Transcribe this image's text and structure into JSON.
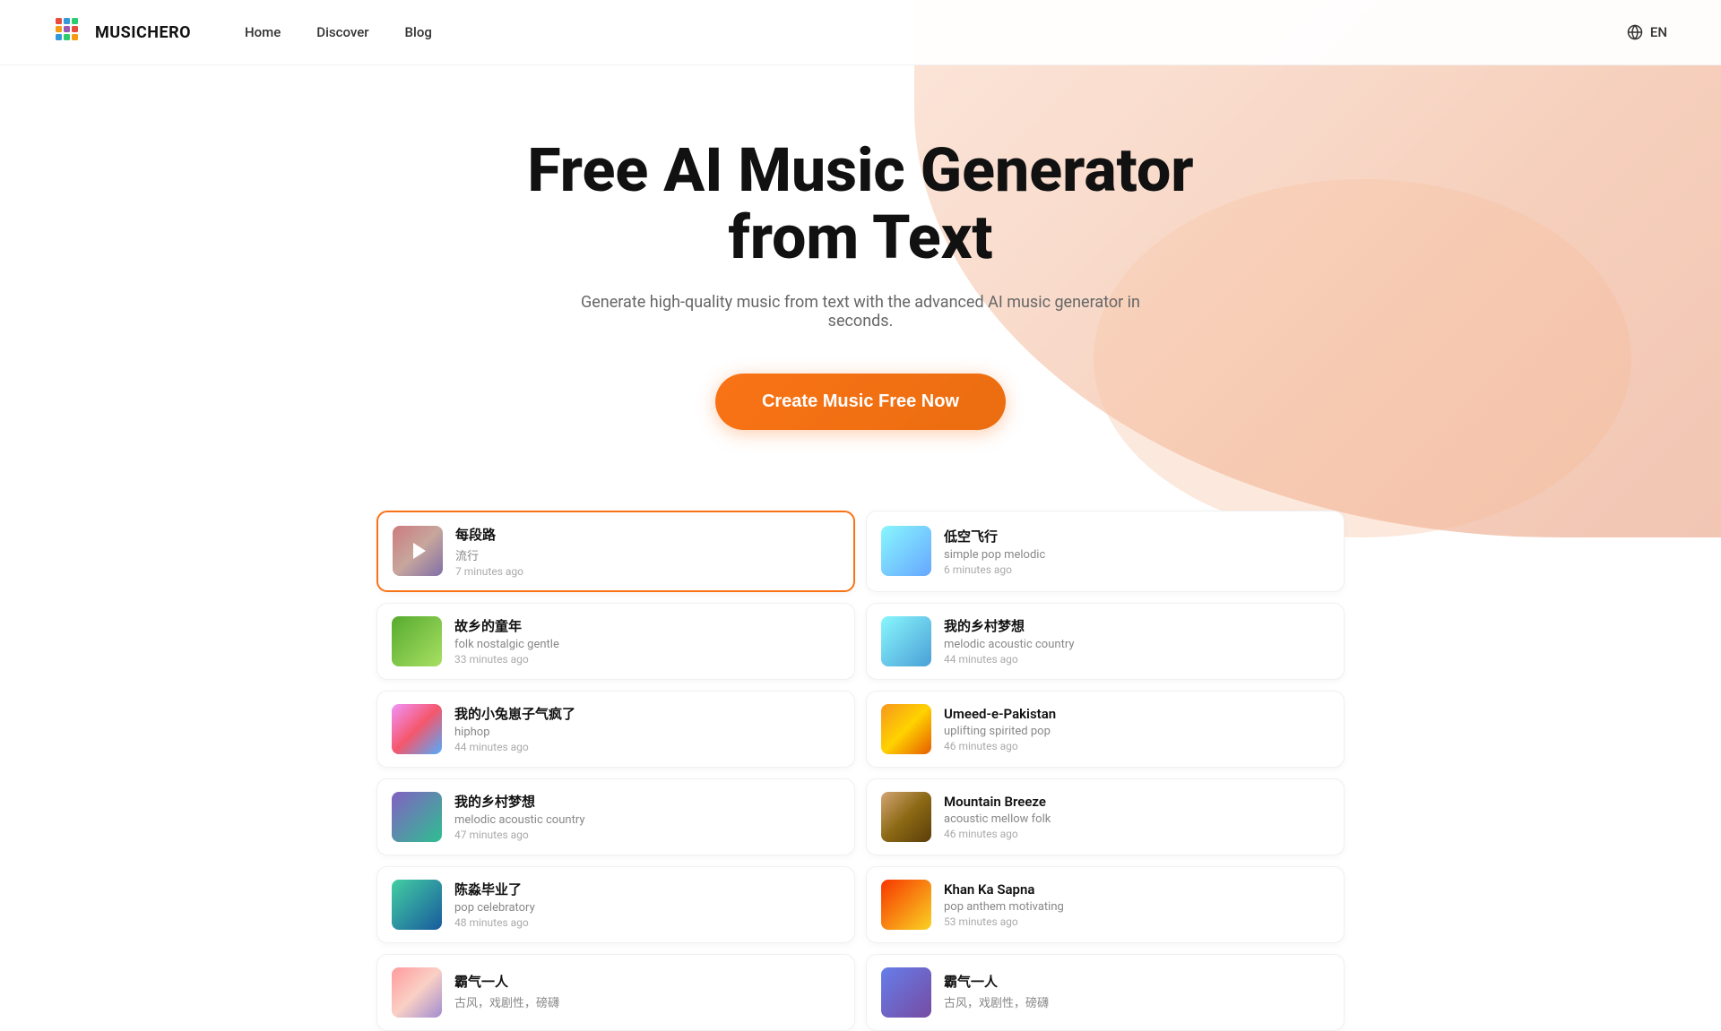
{
  "nav": {
    "logo_text": "MUSICHERO",
    "links": [
      {
        "label": "Home",
        "id": "home"
      },
      {
        "label": "Discover",
        "id": "discover"
      },
      {
        "label": "Blog",
        "id": "blog"
      }
    ],
    "lang": "EN"
  },
  "hero": {
    "title_line1": "Free AI Music Generator",
    "title_line2": "from Text",
    "subtitle": "Generate high-quality music from text with the advanced AI music generator in seconds.",
    "cta_label": "Create Music Free Now"
  },
  "music_cards": [
    {
      "id": "card1",
      "title": "每段路",
      "tags": "流行",
      "time": "7 minutes ago",
      "active": true,
      "thumb_class": "thumb-colorful1"
    },
    {
      "id": "card2",
      "title": "低空飞行",
      "tags": "simple pop melodic",
      "time": "6 minutes ago",
      "active": false,
      "thumb_class": "thumb-sky"
    },
    {
      "id": "card3",
      "title": "故乡的童年",
      "tags": "folk nostalgic gentle",
      "time": "33 minutes ago",
      "active": false,
      "thumb_class": "thumb-nature1"
    },
    {
      "id": "card4",
      "title": "我的乡村梦想",
      "tags": "melodic acoustic country",
      "time": "44 minutes ago",
      "active": false,
      "thumb_class": "thumb-water"
    },
    {
      "id": "card5",
      "title": "我的小兔崽子气疯了",
      "tags": "hiphop",
      "time": "44 minutes ago",
      "active": false,
      "thumb_class": "thumb-mandala"
    },
    {
      "id": "card6",
      "title": "Umeed-e-Pakistan",
      "tags": "uplifting spirited pop",
      "time": "46 minutes ago",
      "active": false,
      "thumb_class": "thumb-sunset"
    },
    {
      "id": "card7",
      "title": "我的乡村梦想",
      "tags": "melodic acoustic country",
      "time": "47 minutes ago",
      "active": false,
      "thumb_class": "thumb-purple"
    },
    {
      "id": "card8",
      "title": "Mountain Breeze",
      "tags": "acoustic mellow folk",
      "time": "46 minutes ago",
      "active": false,
      "thumb_class": "thumb-desert"
    },
    {
      "id": "card9",
      "title": "陈淼毕业了",
      "tags": "pop celebratory",
      "time": "48 minutes ago",
      "active": false,
      "thumb_class": "thumb-landscape"
    },
    {
      "id": "card10",
      "title": "Khan Ka Sapna",
      "tags": "pop anthem motivating",
      "time": "53 minutes ago",
      "active": false,
      "thumb_class": "thumb-fire"
    },
    {
      "id": "card11",
      "title": "霸气一人",
      "tags": "古风，戏剧性，磅礴",
      "time": "",
      "active": false,
      "thumb_class": "thumb-colorful1"
    },
    {
      "id": "card12",
      "title": "霸气一人",
      "tags": "古风，戏剧性，磅礴",
      "time": "",
      "active": false,
      "thumb_class": "thumb-abstract1"
    }
  ]
}
